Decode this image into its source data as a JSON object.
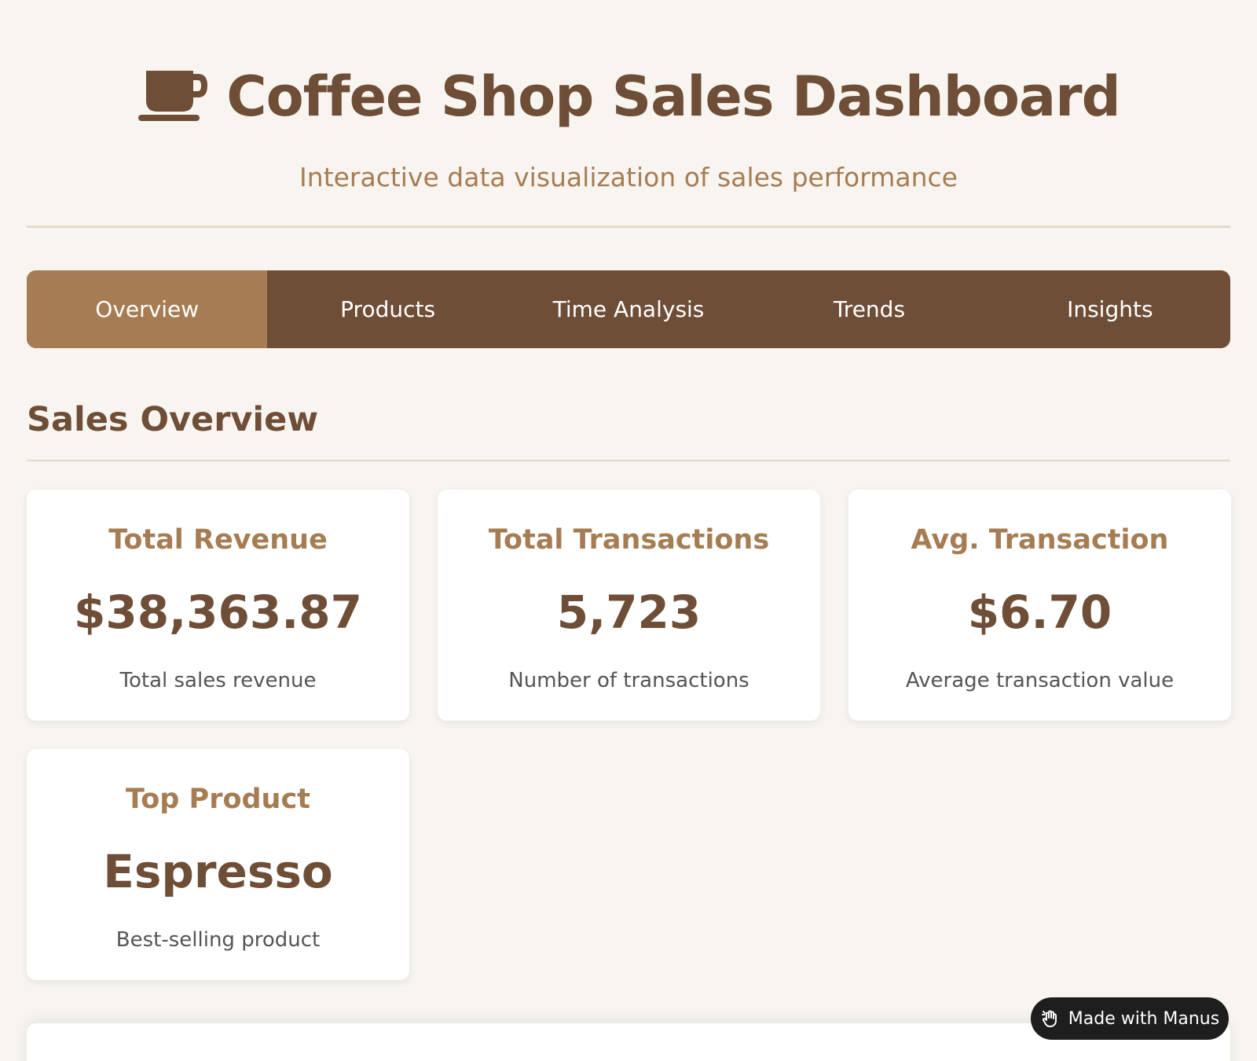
{
  "header": {
    "title": "Coffee Shop Sales Dashboard",
    "subtitle": "Interactive data visualization of sales performance",
    "icon": "coffee-cup-icon"
  },
  "tabs": [
    {
      "label": "Overview",
      "active": true
    },
    {
      "label": "Products",
      "active": false
    },
    {
      "label": "Time Analysis",
      "active": false
    },
    {
      "label": "Trends",
      "active": false
    },
    {
      "label": "Insights",
      "active": false
    }
  ],
  "section": {
    "title": "Sales Overview"
  },
  "cards": [
    {
      "label": "Total Revenue",
      "value": "$38,363.87",
      "caption": "Total sales revenue"
    },
    {
      "label": "Total Transactions",
      "value": "5,723",
      "caption": "Number of transactions"
    },
    {
      "label": "Avg. Transaction",
      "value": "$6.70",
      "caption": "Average transaction value"
    },
    {
      "label": "Top Product",
      "value": "Espresso",
      "caption": "Best-selling product"
    }
  ],
  "badge": {
    "label": "Made with Manus",
    "icon": "manus-hand-icon"
  },
  "colors": {
    "primary": "#6f4e37",
    "accent": "#a67c52",
    "background": "#f8f5f1",
    "card": "#ffffff",
    "badge": "#1e1e1e"
  }
}
